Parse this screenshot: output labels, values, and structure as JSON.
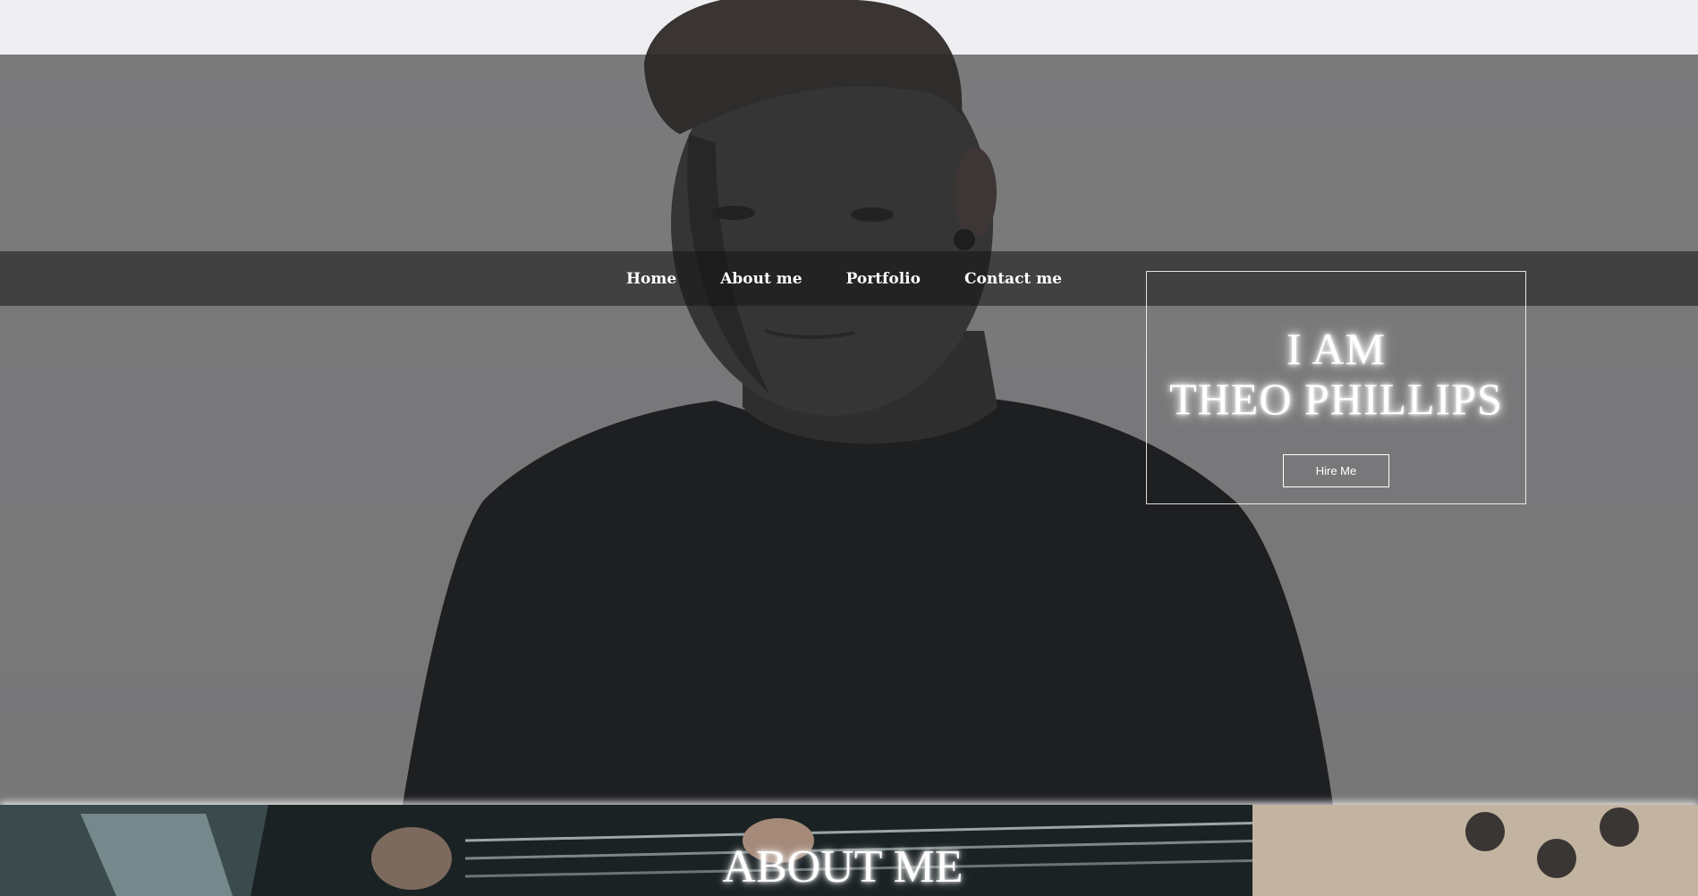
{
  "nav": {
    "items": [
      {
        "label": "Home"
      },
      {
        "label": "About me"
      },
      {
        "label": "Portfolio"
      },
      {
        "label": "Contact me"
      }
    ]
  },
  "intro": {
    "line1": "I AM",
    "line2": "THEO PHILLIPS",
    "hire_label": "Hire Me"
  },
  "about": {
    "title": "ABOUT ME"
  },
  "colors": {
    "overlay": "#282828",
    "text": "#ffffff",
    "nav_bar": "#141414"
  }
}
